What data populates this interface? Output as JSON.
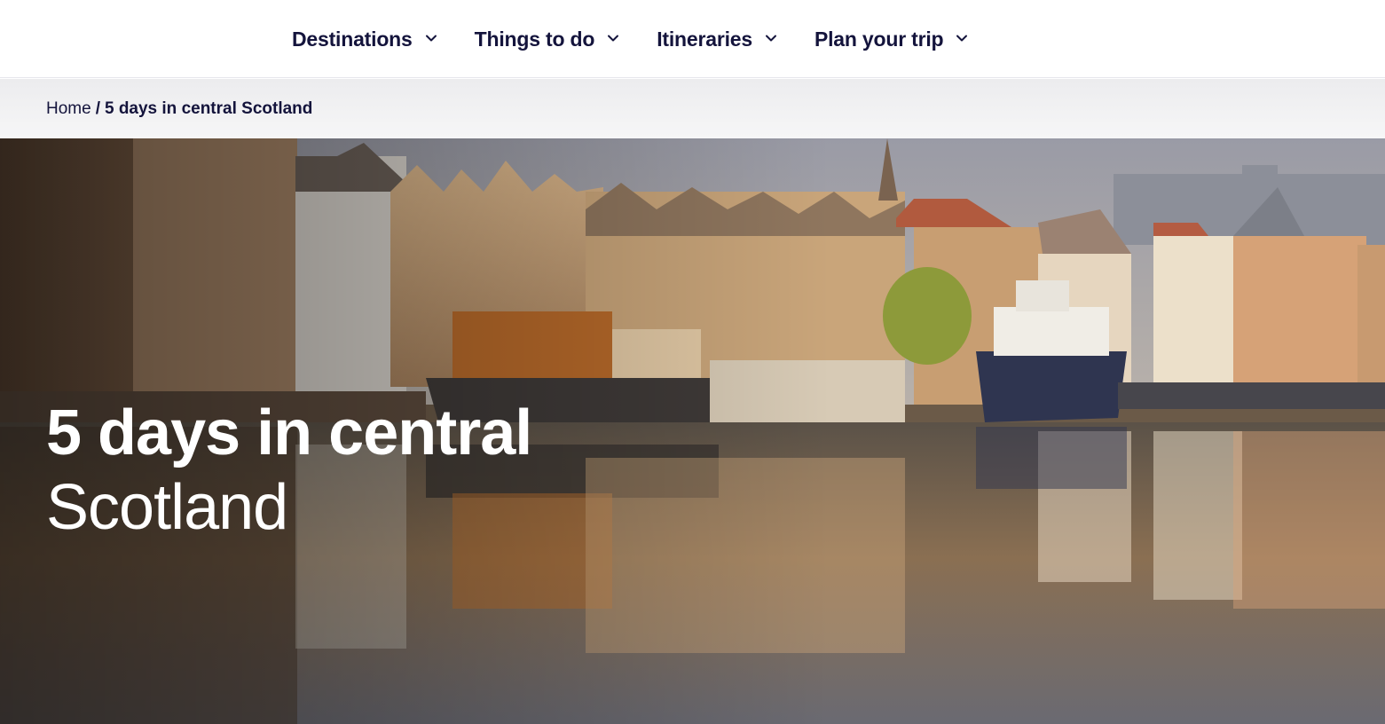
{
  "nav": {
    "items": [
      {
        "label": "Destinations",
        "icon": "chevron-down-icon"
      },
      {
        "label": "Things to do",
        "icon": "chevron-down-icon"
      },
      {
        "label": "Itineraries",
        "icon": "chevron-down-icon"
      },
      {
        "label": "Plan your trip",
        "icon": "chevron-down-icon"
      }
    ]
  },
  "breadcrumb": {
    "home": "Home",
    "separator": "/",
    "current": "5 days in central Scotland"
  },
  "hero": {
    "title_line1": "5 days in central",
    "title_line2": "Scotland",
    "image": "waterfront-buildings-reflected-in-river"
  },
  "colors": {
    "nav_text": "#14143c",
    "breadcrumb_bg": "#f0f0f2",
    "hero_text": "#ffffff"
  }
}
